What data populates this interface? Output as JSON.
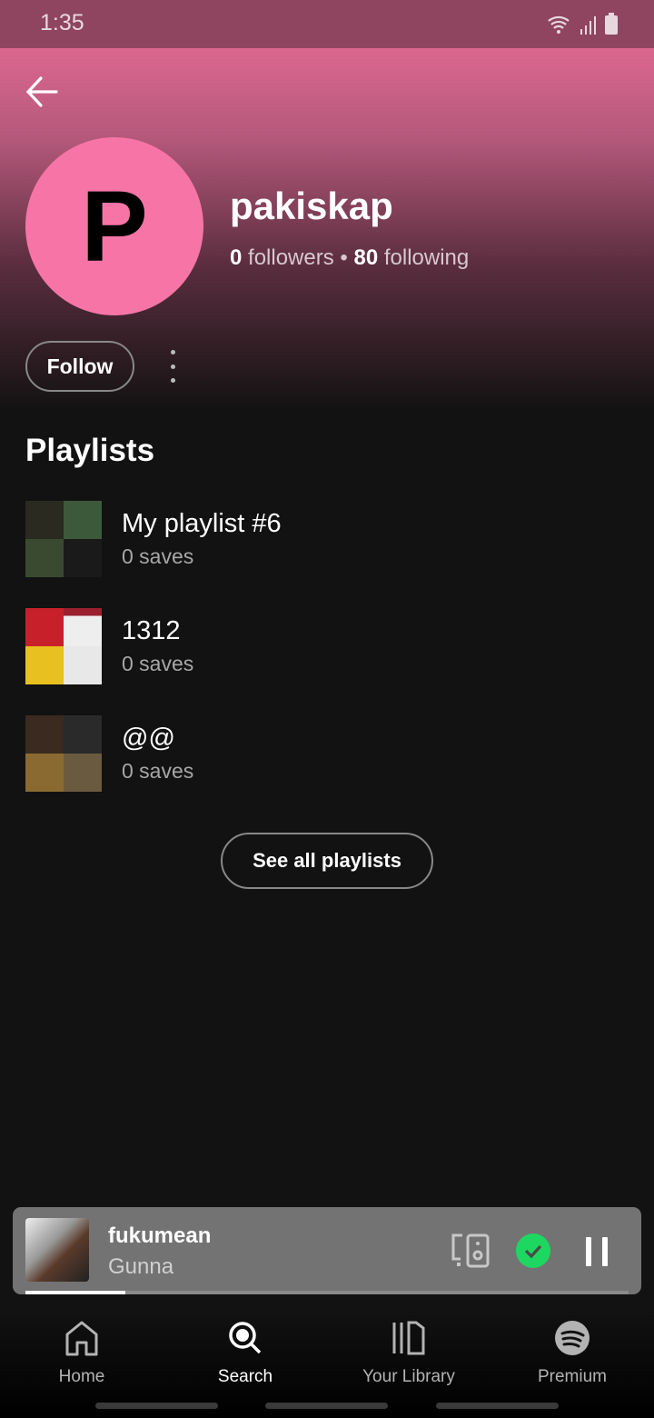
{
  "status_bar": {
    "time": "1:35"
  },
  "profile": {
    "initial": "P",
    "username": "pakiskap",
    "followers_count": "0",
    "followers_label": "followers",
    "following_count": "80",
    "following_label": "following",
    "follow_label": "Follow",
    "avatar_color": "#f675a6"
  },
  "playlists": {
    "title": "Playlists",
    "items": [
      {
        "name": "My playlist #6",
        "saves": "0 saves"
      },
      {
        "name": "1312",
        "saves": "0 saves"
      },
      {
        "name": "@@",
        "saves": "0 saves"
      }
    ],
    "see_all_label": "See all playlists"
  },
  "now_playing": {
    "song": "fukumean",
    "artist": "Gunna",
    "progress": 0.165,
    "accent": "#1ed760"
  },
  "nav": {
    "items": [
      {
        "label": "Home"
      },
      {
        "label": "Search"
      },
      {
        "label": "Your Library"
      },
      {
        "label": "Premium"
      }
    ]
  }
}
